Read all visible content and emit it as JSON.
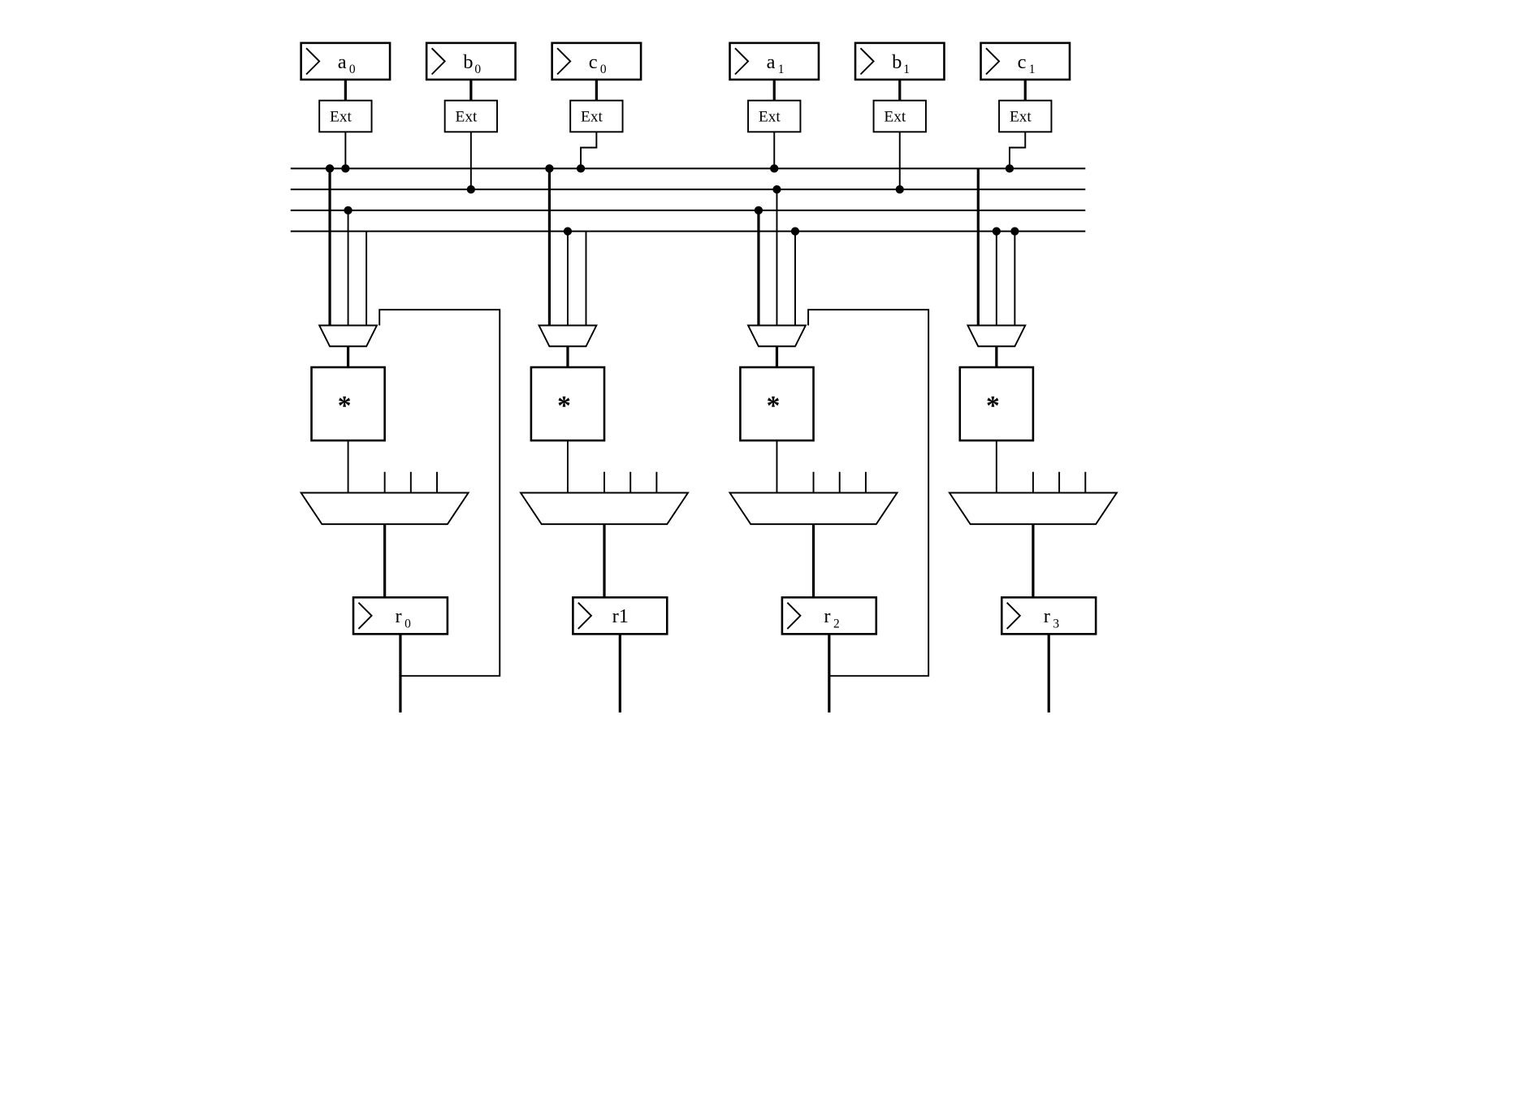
{
  "inputs": [
    {
      "label": "a",
      "sub": "0"
    },
    {
      "label": "b",
      "sub": "0"
    },
    {
      "label": "c",
      "sub": "0"
    },
    {
      "label": "a",
      "sub": "1"
    },
    {
      "label": "b",
      "sub": "1"
    },
    {
      "label": "c",
      "sub": "1"
    }
  ],
  "ext_label": "Ext",
  "mult_label": "*",
  "outputs": [
    {
      "label": "r",
      "sub": "0"
    },
    {
      "label": "r",
      "sub": "1",
      "plain": "r1"
    },
    {
      "label": "r",
      "sub": "2"
    },
    {
      "label": "r",
      "sub": "3"
    }
  ]
}
